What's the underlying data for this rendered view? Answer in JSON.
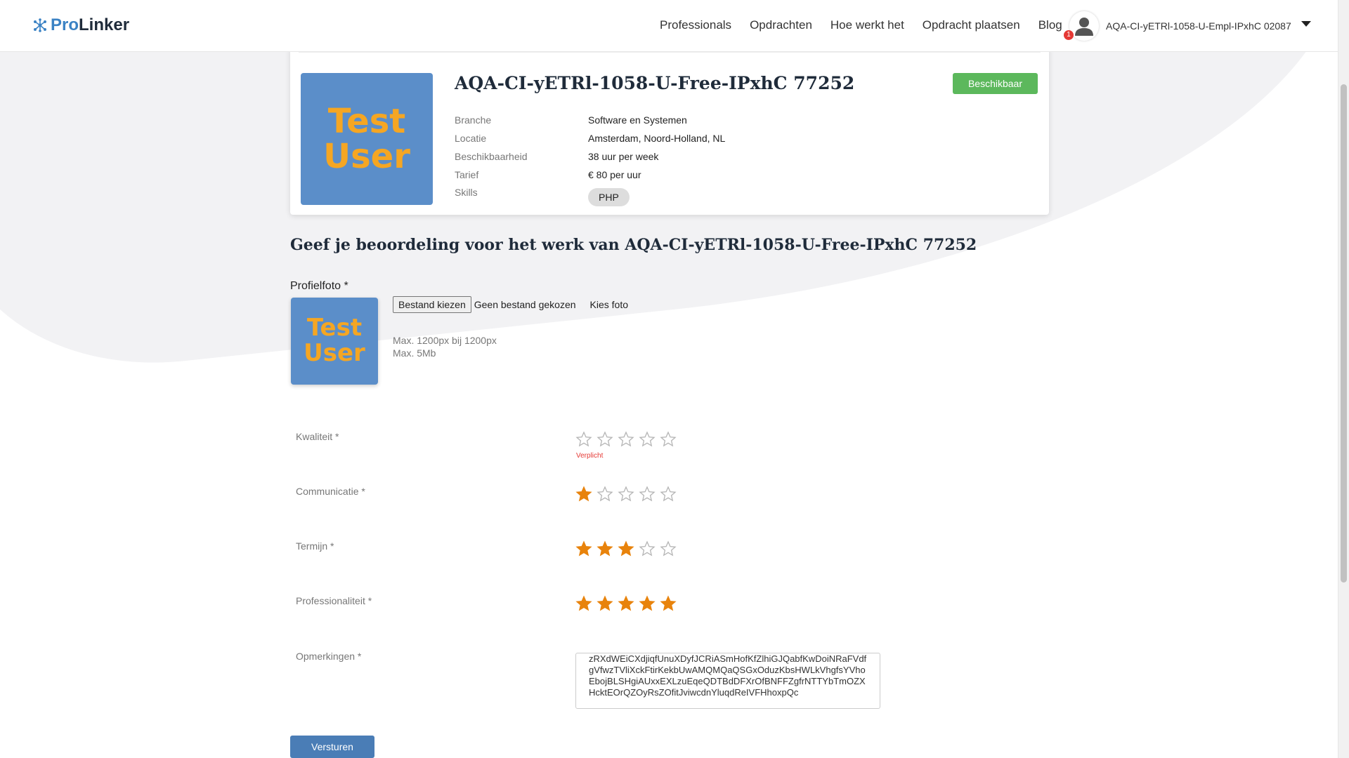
{
  "header": {
    "logo_pro": "Pro",
    "logo_linker": "Linker",
    "nav": [
      "Professionals",
      "Opdrachten",
      "Hoe werkt het",
      "Opdracht plaatsen",
      "Blog"
    ],
    "user_name": "AQA-CI-yETRl-1058-U-Empl-IPxhC 02087",
    "notification_count": "1"
  },
  "profile_card": {
    "name": "AQA-CI-yETRl-1058-U-Free-IPxhC 77252",
    "image_text_line1": "Test",
    "image_text_line2": "User",
    "status_badge": "Beschikbaar",
    "status_color": "#5cb85c",
    "fields": [
      {
        "label": "Branche",
        "value": "Software en Systemen"
      },
      {
        "label": "Locatie",
        "value": "Amsterdam, Noord-Holland, NL"
      },
      {
        "label": "Beschikbaarheid",
        "value": "38 uur per week"
      },
      {
        "label": "Tarief",
        "value": "€ 80 per uur"
      }
    ],
    "skills_label": "Skills",
    "skills": [
      "PHP"
    ]
  },
  "review": {
    "heading": "Geef je beoordeling voor het werk van AQA-CI-yETRl-1058-U-Free-IPxhC 77252",
    "photo_label": "Profielfoto *",
    "file_button": "Bestand kiezen",
    "file_status": "Geen bestand gekozen",
    "choose_photo": "Kies foto",
    "hint_line1": "Max. 1200px bij 1200px",
    "hint_line2": "Max. 5Mb",
    "ratings": [
      {
        "label": "Kwaliteit *",
        "value": 0,
        "error": "Verplicht"
      },
      {
        "label": "Communicatie *",
        "value": 1
      },
      {
        "label": "Termijn *",
        "value": 3
      },
      {
        "label": "Professionaliteit *",
        "value": 5
      }
    ],
    "max_stars": 5,
    "star_color": "#e8830c",
    "comments_label": "Opmerkingen *",
    "comments_value": "zRXdWEiCXdjiqfUnuXDyfJCRiASmHofKfZlhiGJQabfKwDoiNRaFVdfgVfwzTVliXckFtirKekbUwAMQMQaQSGxOduzKbsHWLkVhgfsYVhoEbojBLSHgiAUxxEXLzuEqeQDTBdDFXrOfBNFFZgfrNTTYbTmOZXHcktEOrQZOyRsZOfitJviwcdnYluqdReIVFHhoxpQc",
    "submit_label": "Versturen"
  }
}
